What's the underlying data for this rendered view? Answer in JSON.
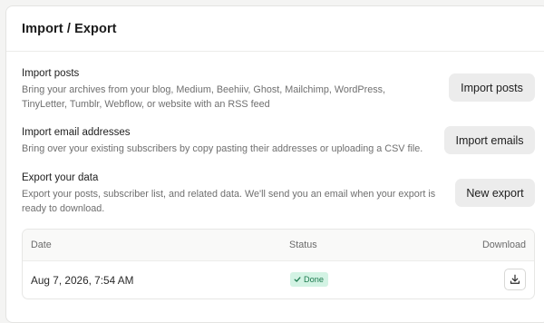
{
  "panel": {
    "title": "Import / Export"
  },
  "import_posts": {
    "title": "Import posts",
    "description": "Bring your archives from your blog, Medium, Beehiiv, Ghost, Mailchimp, WordPress, TinyLetter, Tumblr, Webflow, or website with an RSS feed",
    "button_label": "Import posts"
  },
  "import_emails": {
    "title": "Import email addresses",
    "description": "Bring over your existing subscribers by copy pasting their addresses or uploading a CSV file.",
    "button_label": "Import emails"
  },
  "export_data": {
    "title": "Export your data",
    "description": "Export your posts, subscriber list, and related data. We'll send you an email when your export is ready to download.",
    "button_label": "New export"
  },
  "exports_table": {
    "headers": {
      "date": "Date",
      "status": "Status",
      "download": "Download"
    },
    "rows": [
      {
        "date": "Aug 7, 2026, 7:54 AM",
        "status": "Done",
        "download_icon": "download-icon"
      }
    ]
  },
  "colors": {
    "badge_bg": "#d3f3e4",
    "badge_text": "#1c7a4e",
    "button_bg": "#ececec"
  }
}
